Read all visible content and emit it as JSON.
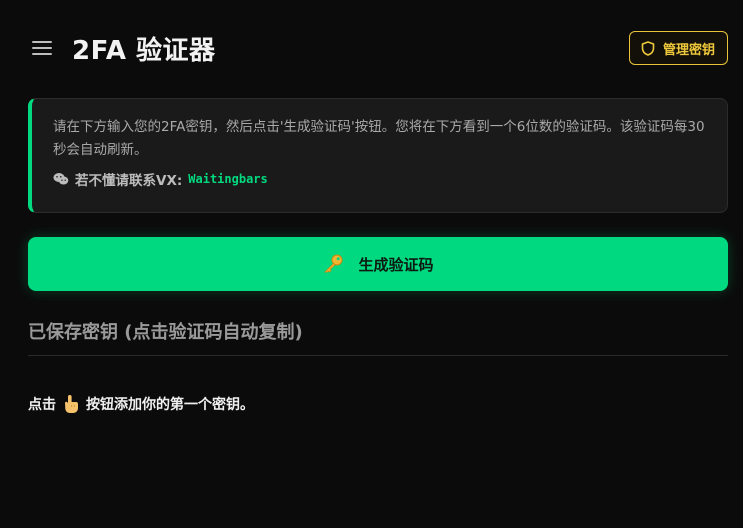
{
  "header": {
    "title": "2FA 验证器",
    "menu_icon": "hamburger-icon",
    "manage_label": "管理密钥",
    "manage_icon": "shield-icon"
  },
  "info": {
    "text": "请在下方输入您的2FA密钥，然后点击'生成验证码'按钮。您将在下方看到一个6位数的验证码。该验证码每30秒会自动刷新。",
    "contact_label": "若不懂请联系VX:",
    "contact_id": "Waitingbars",
    "contact_icon": "wechat-icon"
  },
  "generate": {
    "label": "生成验证码",
    "icon": "key-icon"
  },
  "saved": {
    "title": "已保存密钥 (点击验证码自动复制)",
    "empty_prefix": "点击",
    "empty_icon": "pointing-hand-icon",
    "empty_suffix": "按钮添加你的第一个密钥。"
  },
  "colors": {
    "background": "#0b0b0b",
    "accent": "#00d97f",
    "warning": "#f0c83c",
    "card": "#1a1a1a"
  }
}
